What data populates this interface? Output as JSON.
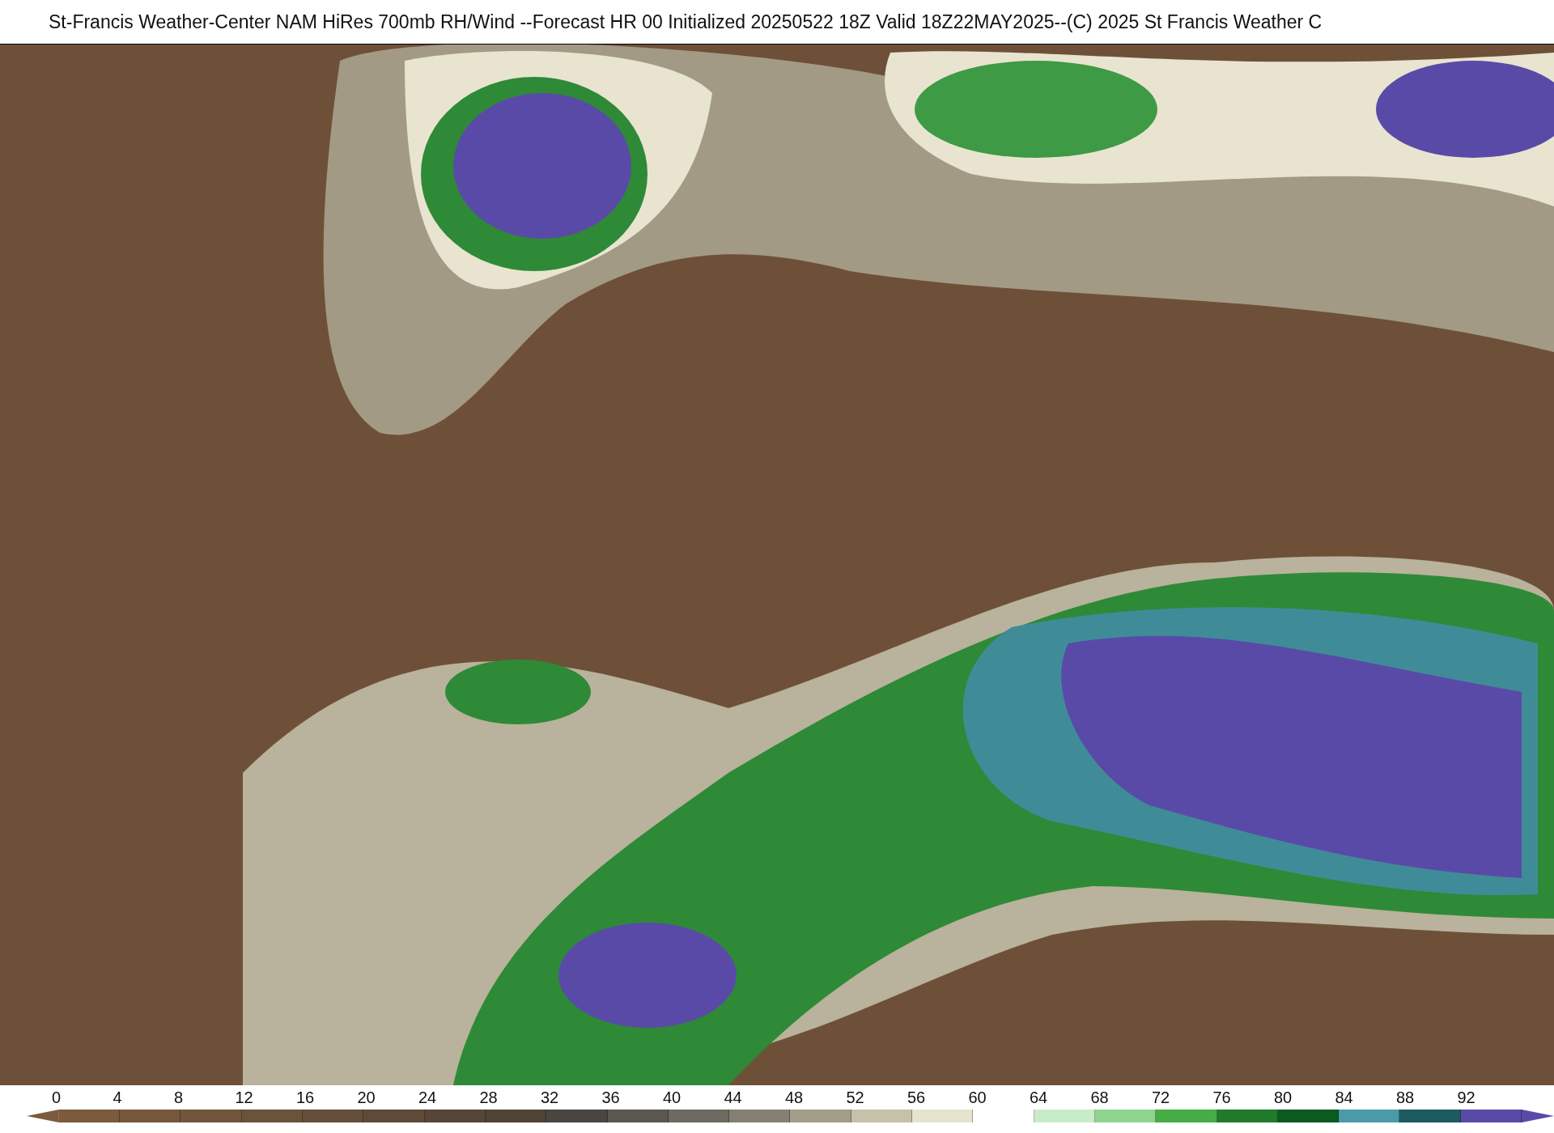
{
  "title": "St-Francis Weather-Center NAM HiRes 700mb RH/Wind  --Forecast HR 00 Initialized 20250522 18Z Valid 18Z22MAY2025--(C) 2025 St Francis Weather C",
  "colorbar": {
    "ticks": [
      "0",
      "4",
      "8",
      "12",
      "16",
      "20",
      "24",
      "28",
      "32",
      "36",
      "40",
      "44",
      "48",
      "52",
      "56",
      "60",
      "64",
      "68",
      "72",
      "76",
      "80",
      "84",
      "88",
      "92"
    ],
    "swatches": [
      {
        "color": "#7b5a3d"
      },
      {
        "color": "#76573c"
      },
      {
        "color": "#71553c"
      },
      {
        "color": "#6b523b"
      },
      {
        "color": "#654e3a"
      },
      {
        "color": "#5e4a39"
      },
      {
        "color": "#564538"
      },
      {
        "color": "#4f4337"
      },
      {
        "color": "#4a4540"
      },
      {
        "color": "#5a5650"
      },
      {
        "color": "#6e6a62"
      },
      {
        "color": "#858073"
      },
      {
        "color": "#a29c88"
      },
      {
        "color": "#c6c1a8"
      },
      {
        "color": "#e6e3cf"
      },
      {
        "color": "#ffffff"
      },
      {
        "color": "#c8ecc8"
      },
      {
        "color": "#8fd48f"
      },
      {
        "color": "#46ac46"
      },
      {
        "color": "#1f7a2a"
      },
      {
        "color": "#0b5a20"
      },
      {
        "color": "#4a9aa8"
      },
      {
        "color": "#1e5a62"
      },
      {
        "color": "#5a4aa8"
      }
    ]
  }
}
